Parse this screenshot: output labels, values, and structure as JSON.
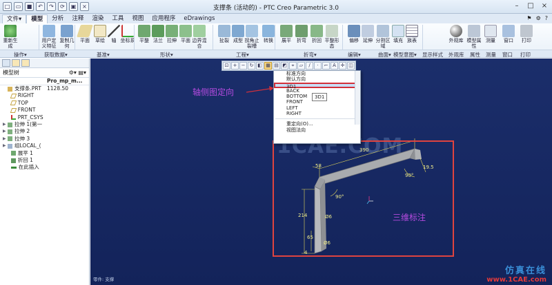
{
  "window": {
    "title": "支撑条 (活动的) - PTC Creo Parametric 3.0"
  },
  "tabs": [
    {
      "label": "文件▾"
    },
    {
      "label": "模型"
    },
    {
      "label": "分析"
    },
    {
      "label": "注释"
    },
    {
      "label": "渲染"
    },
    {
      "label": "工具"
    },
    {
      "label": "视图"
    },
    {
      "label": "应用程序"
    },
    {
      "label": "eDrawings"
    }
  ],
  "ribbon": {
    "buttons": [
      {
        "label": "重新生成"
      },
      {
        "label": "用户定义特征"
      },
      {
        "label": "复制几何"
      },
      {
        "label": "平面"
      },
      {
        "label": "草绘"
      },
      {
        "label": "轴"
      },
      {
        "label": "坐标系"
      },
      {
        "label": "平整"
      },
      {
        "label": "法兰"
      },
      {
        "label": "拉伸"
      },
      {
        "label": "平面"
      },
      {
        "label": "边界混合"
      },
      {
        "label": "扯裂"
      },
      {
        "label": "成型"
      },
      {
        "label": "拐角止裂槽"
      },
      {
        "label": "转换"
      },
      {
        "label": "展平"
      },
      {
        "label": "折弯"
      },
      {
        "label": "折回"
      },
      {
        "label": "平整形态"
      },
      {
        "label": "偏移"
      },
      {
        "label": "延伸"
      },
      {
        "label": "分割区域"
      },
      {
        "label": "填充"
      },
      {
        "label": "族表"
      },
      {
        "label": "外观库"
      },
      {
        "label": "模型属性"
      },
      {
        "label": "测量"
      },
      {
        "label": "窗口"
      },
      {
        "label": "打印"
      }
    ],
    "groups": [
      {
        "label": "操作▾"
      },
      {
        "label": "获取数据▾"
      },
      {
        "label": "基准▾"
      },
      {
        "label": "形状▾"
      },
      {
        "label": "工程▾"
      },
      {
        "label": "折弯▾"
      },
      {
        "label": "编辑▾"
      },
      {
        "label": "曲面▾"
      },
      {
        "label": "模型意图▾"
      },
      {
        "label": "显示样式"
      },
      {
        "label": "外观库"
      },
      {
        "label": "属性"
      },
      {
        "label": "测量"
      },
      {
        "label": "窗口"
      },
      {
        "label": "打印"
      }
    ]
  },
  "model_tree": {
    "title": "模型树",
    "column_header": "Pro_mp_m...",
    "items": [
      {
        "label": "支撑条.PRT",
        "value": "1128.50",
        "icon": "part-icon"
      },
      {
        "label": "RIGHT",
        "icon": "datum-plane-icon"
      },
      {
        "label": "TOP",
        "icon": "datum-plane-icon"
      },
      {
        "label": "FRONT",
        "icon": "datum-plane-icon"
      },
      {
        "label": "PRT_CSYS",
        "icon": "csys-icon"
      },
      {
        "label": "拉伸 1(第一",
        "icon": "extrude-icon"
      },
      {
        "label": "拉伸 2",
        "icon": "extrude-icon"
      },
      {
        "label": "拉伸 3",
        "icon": "extrude-icon"
      },
      {
        "label": "组LOCAL_(",
        "icon": "group-icon"
      },
      {
        "label": "展平 1",
        "icon": "unbend-icon"
      },
      {
        "label": "折回 1",
        "icon": "bendback-icon"
      },
      {
        "label": "在此插入",
        "icon": "insert-icon"
      }
    ]
  },
  "view_dropdown": {
    "items": [
      {
        "label": "标准方向"
      },
      {
        "label": "默认方向"
      },
      {
        "label": "3D1"
      },
      {
        "label": "BACK"
      },
      {
        "label": "BOTTOM"
      },
      {
        "label": "FRONT"
      },
      {
        "label": "LEFT"
      },
      {
        "label": "RIGHT"
      }
    ],
    "highlighted": "3D1",
    "actions": [
      {
        "label": "重定向(O)..."
      },
      {
        "label": "视图法向"
      }
    ],
    "tooltip": "3D1"
  },
  "annotations": {
    "axis_view": "轴侧图定向",
    "dimension": "三维标注"
  },
  "dimensions": [
    "390",
    "58",
    "19.5",
    "90°",
    "90°",
    "214",
    "65",
    "Ø6",
    "Ø6",
    "4"
  ],
  "watermark": "1CAE.COM",
  "status_text": "零件: 支撑",
  "logo": {
    "big": "仿真在线",
    "small": "www.1CAE.com"
  },
  "colors": {
    "viewport": "#1b2e6b",
    "annotation": "#b64be0",
    "highlight_box": "#e0443f"
  }
}
